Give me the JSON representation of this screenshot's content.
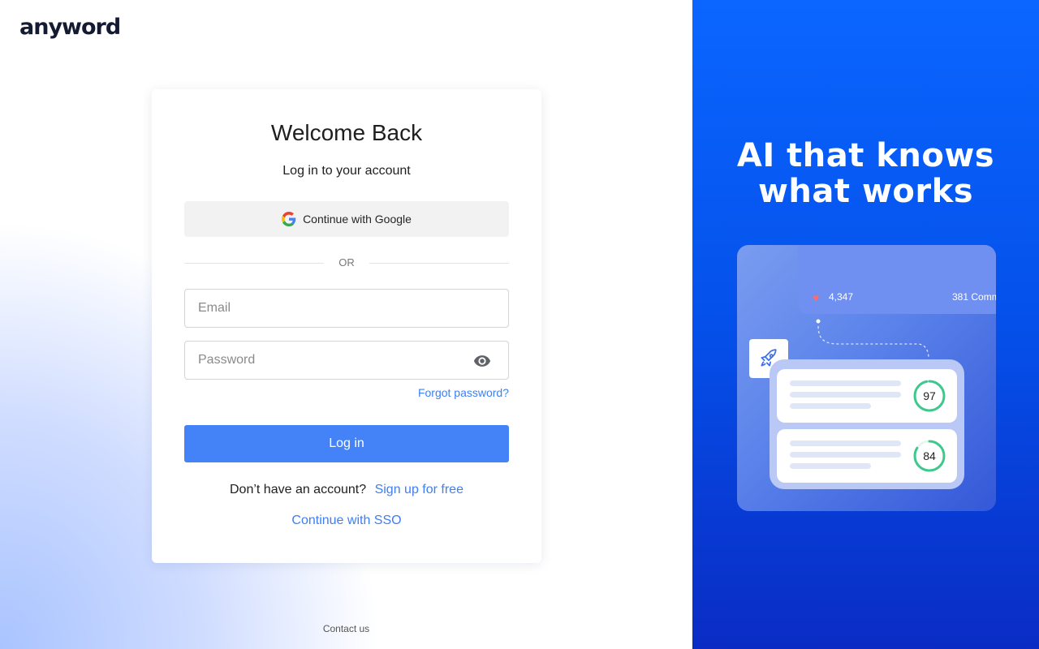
{
  "brand": {
    "logo_text": "anyword"
  },
  "login": {
    "title": "Welcome Back",
    "subtitle": "Log in to your account",
    "google_button": "Continue with Google",
    "divider": "OR",
    "email_placeholder": "Email",
    "email_value": "",
    "password_placeholder": "Password",
    "password_value": "",
    "forgot_link": "Forgot password?",
    "login_button": "Log in",
    "no_account_text": "Don’t have an account?",
    "signup_link": "Sign up for free",
    "sso_link": "Continue with SSO"
  },
  "footer": {
    "contact": "Contact us"
  },
  "promo": {
    "headline_line1": "AI that knows",
    "headline_line2": "what works",
    "likes_count": "4,347",
    "comments_text": "381 Comm",
    "scores": [
      "97",
      "84"
    ],
    "score_fraction": [
      0.97,
      0.84
    ]
  },
  "colors": {
    "accent": "#4383f7",
    "link": "#3d7ff5",
    "promo_bg": "#0550ea",
    "score_ring": "#3fc88e"
  },
  "icons": [
    "google-icon",
    "eye-icon",
    "heart-icon",
    "rocket-icon"
  ]
}
